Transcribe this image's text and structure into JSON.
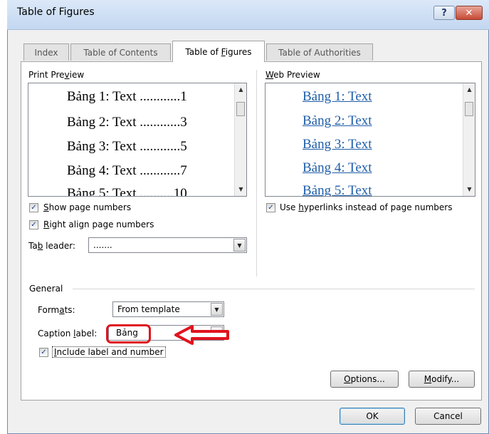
{
  "window": {
    "title": "Table of Figures",
    "help_label": "?",
    "close_label": "✕"
  },
  "tabs": [
    {
      "label": "Index",
      "active": false
    },
    {
      "label": "Table of Contents",
      "active": false
    },
    {
      "label": "Table of Figures",
      "active": true
    },
    {
      "label": "Table of Authorities",
      "active": false
    }
  ],
  "print_preview": {
    "label": "Print Preview",
    "lines": [
      "Bảng 1: Text ............1",
      "Bảng 2: Text ............3",
      "Bảng 3: Text ............5",
      "Bảng 4: Text ............7",
      "Bảng 5: Text ..........10"
    ]
  },
  "web_preview": {
    "label": "Web Preview",
    "lines": [
      "Bảng 1: Text",
      "Bảng 2: Text",
      "Bảng 3: Text",
      "Bảng 4: Text",
      "Bảng 5: Text"
    ],
    "link_color": "#1f5ea8"
  },
  "options": {
    "show_page_numbers": {
      "label": "Show page numbers",
      "checked": true
    },
    "right_align": {
      "label": "Right align page numbers",
      "checked": true
    },
    "use_hyperlinks": {
      "label": "Use hyperlinks instead of page numbers",
      "checked": true
    },
    "include_label": {
      "label": "Include label and number",
      "checked": true
    }
  },
  "tab_leader": {
    "label": "Tab leader:",
    "value": "......."
  },
  "general": {
    "label": "General",
    "formats": {
      "label": "Formats:",
      "value": "From template"
    },
    "caption": {
      "label": "Caption label:",
      "value": "Bảng"
    }
  },
  "buttons": {
    "options": "Options...",
    "modify": "Modify...",
    "ok": "OK",
    "cancel": "Cancel"
  },
  "colors": {
    "annotation": "#e0141e",
    "title_bar": "#c3d7f1"
  }
}
